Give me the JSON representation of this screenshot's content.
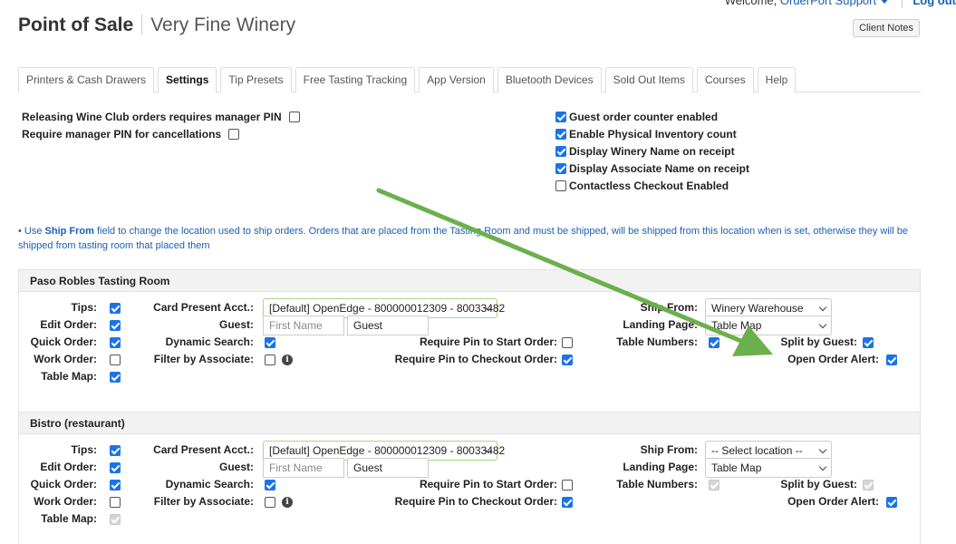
{
  "header": {
    "welcome_prefix": "Welcome,",
    "user": "OrderPort Support",
    "logout": "Log out",
    "app_title": "Point of Sale",
    "winery_name": "Very Fine Winery",
    "client_notes": "Client Notes"
  },
  "tabs": [
    {
      "label": "Printers & Cash Drawers",
      "active": false
    },
    {
      "label": "Settings",
      "active": true
    },
    {
      "label": "Tip Presets",
      "active": false
    },
    {
      "label": "Free Tasting Tracking",
      "active": false
    },
    {
      "label": "App Version",
      "active": false
    },
    {
      "label": "Bluetooth Devices",
      "active": false
    },
    {
      "label": "Sold Out Items",
      "active": false
    },
    {
      "label": "Courses",
      "active": false
    },
    {
      "label": "Help",
      "active": false
    }
  ],
  "global_settings": {
    "left": [
      {
        "label": "Releasing Wine Club orders requires manager PIN",
        "checked": false
      },
      {
        "label": "Require manager PIN for cancellations",
        "checked": false
      }
    ],
    "right": [
      {
        "label": "Guest order counter enabled",
        "checked": true
      },
      {
        "label": "Enable Physical Inventory count",
        "checked": true
      },
      {
        "label": "Display Winery Name on receipt",
        "checked": true
      },
      {
        "label": "Display Associate Name on receipt",
        "checked": true
      },
      {
        "label": "Contactless Checkout Enabled",
        "checked": false
      }
    ]
  },
  "info_note": {
    "bullet": "•",
    "prefix": "Use",
    "bold": "Ship From",
    "text": "field to change the location used to ship orders. Orders that are placed from the Tasting Room and must be shipped, will be shipped from this location when is set, otherwise they will be shipped from tasting room that placed them"
  },
  "labels": {
    "tips": "Tips:",
    "edit_order": "Edit Order:",
    "quick_order": "Quick Order:",
    "work_order": "Work Order:",
    "table_map": "Table Map:",
    "card_present": "Card Present Acct.:",
    "guest": "Guest:",
    "dynamic_search": "Dynamic Search:",
    "filter_by_associate": "Filter by Associate:",
    "require_pin_start": "Require Pin to Start Order:",
    "require_pin_checkout": "Require Pin to Checkout Order:",
    "ship_from": "Ship From:",
    "landing_page": "Landing Page:",
    "table_numbers": "Table Numbers:",
    "split_by_guest": "Split by Guest:",
    "open_order_alert": "Open Order Alert:",
    "info_glyph": "i"
  },
  "locations": [
    {
      "name": "Paso Robles Tasting Room",
      "tips": "checked",
      "edit_order": "checked",
      "quick_order": "checked",
      "work_order": "unchecked",
      "table_map": "checked",
      "card_present_account": "[Default] OpenEdge - 800000012309 - 80033482",
      "guest_first_placeholder": "First Name",
      "guest_default": "Guest",
      "dynamic_search": "checked",
      "filter_by_associate": "unchecked",
      "require_pin_start": "unchecked",
      "require_pin_checkout": "checked",
      "ship_from": "Winery Warehouse",
      "landing_page": "Table Map",
      "table_numbers": "checked",
      "split_by_guest": "checked",
      "open_order_alert": "checked"
    },
    {
      "name": "Bistro (restaurant)",
      "tips": "checked",
      "edit_order": "checked",
      "quick_order": "checked",
      "work_order": "unchecked",
      "table_map": "disabled",
      "card_present_account": "[Default] OpenEdge - 800000012309 - 80033482",
      "guest_first_placeholder": "First Name",
      "guest_default": "Guest",
      "dynamic_search": "checked",
      "filter_by_associate": "unchecked",
      "require_pin_start": "unchecked",
      "require_pin_checkout": "checked",
      "ship_from": "-- Select location --",
      "landing_page": "Table Map",
      "table_numbers": "disabled",
      "split_by_guest": "disabled",
      "open_order_alert": "checked"
    }
  ],
  "colors": {
    "accent": "#1a73e8",
    "link": "#1a5fb4",
    "annotation_arrow": "#6ab04c"
  }
}
